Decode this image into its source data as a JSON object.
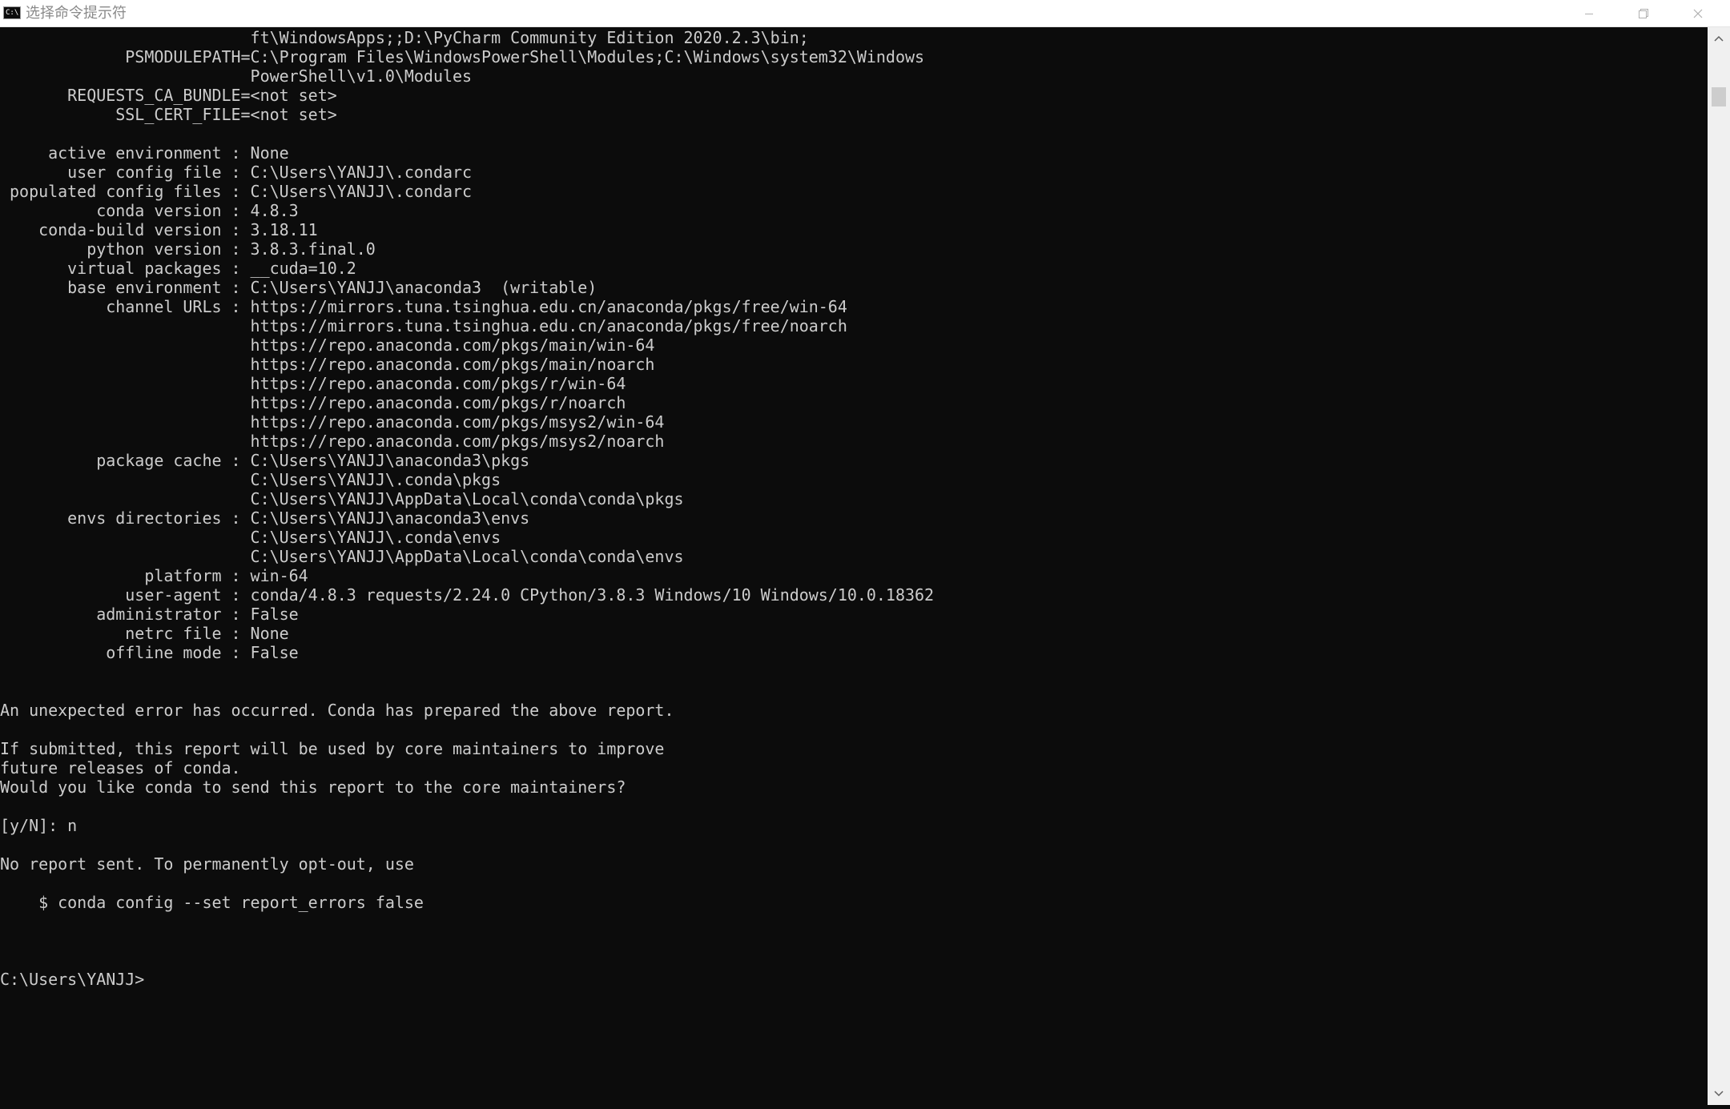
{
  "window": {
    "title": "选择命令提示符",
    "icon_label": "C:\\"
  },
  "console": {
    "lines": [
      "                          ft\\WindowsApps;;D:\\PyCharm Community Edition 2020.2.3\\bin;",
      "             PSMODULEPATH=C:\\Program Files\\WindowsPowerShell\\Modules;C:\\Windows\\system32\\Windows",
      "                          PowerShell\\v1.0\\Modules",
      "       REQUESTS_CA_BUNDLE=<not set>",
      "            SSL_CERT_FILE=<not set>",
      "",
      "     active environment : None",
      "       user config file : C:\\Users\\YANJJ\\.condarc",
      " populated config files : C:\\Users\\YANJJ\\.condarc",
      "          conda version : 4.8.3",
      "    conda-build version : 3.18.11",
      "         python version : 3.8.3.final.0",
      "       virtual packages : __cuda=10.2",
      "       base environment : C:\\Users\\YANJJ\\anaconda3  (writable)",
      "           channel URLs : https://mirrors.tuna.tsinghua.edu.cn/anaconda/pkgs/free/win-64",
      "                          https://mirrors.tuna.tsinghua.edu.cn/anaconda/pkgs/free/noarch",
      "                          https://repo.anaconda.com/pkgs/main/win-64",
      "                          https://repo.anaconda.com/pkgs/main/noarch",
      "                          https://repo.anaconda.com/pkgs/r/win-64",
      "                          https://repo.anaconda.com/pkgs/r/noarch",
      "                          https://repo.anaconda.com/pkgs/msys2/win-64",
      "                          https://repo.anaconda.com/pkgs/msys2/noarch",
      "          package cache : C:\\Users\\YANJJ\\anaconda3\\pkgs",
      "                          C:\\Users\\YANJJ\\.conda\\pkgs",
      "                          C:\\Users\\YANJJ\\AppData\\Local\\conda\\conda\\pkgs",
      "       envs directories : C:\\Users\\YANJJ\\anaconda3\\envs",
      "                          C:\\Users\\YANJJ\\.conda\\envs",
      "                          C:\\Users\\YANJJ\\AppData\\Local\\conda\\conda\\envs",
      "               platform : win-64",
      "             user-agent : conda/4.8.3 requests/2.24.0 CPython/3.8.3 Windows/10 Windows/10.0.18362",
      "          administrator : False",
      "             netrc file : None",
      "           offline mode : False",
      "",
      "",
      "An unexpected error has occurred. Conda has prepared the above report.",
      "",
      "If submitted, this report will be used by core maintainers to improve",
      "future releases of conda.",
      "Would you like conda to send this report to the core maintainers?",
      "",
      "[y/N]: n",
      "",
      "No report sent. To permanently opt-out, use",
      "",
      "    $ conda config --set report_errors false",
      "",
      "",
      "",
      "C:\\Users\\YANJJ>"
    ]
  }
}
